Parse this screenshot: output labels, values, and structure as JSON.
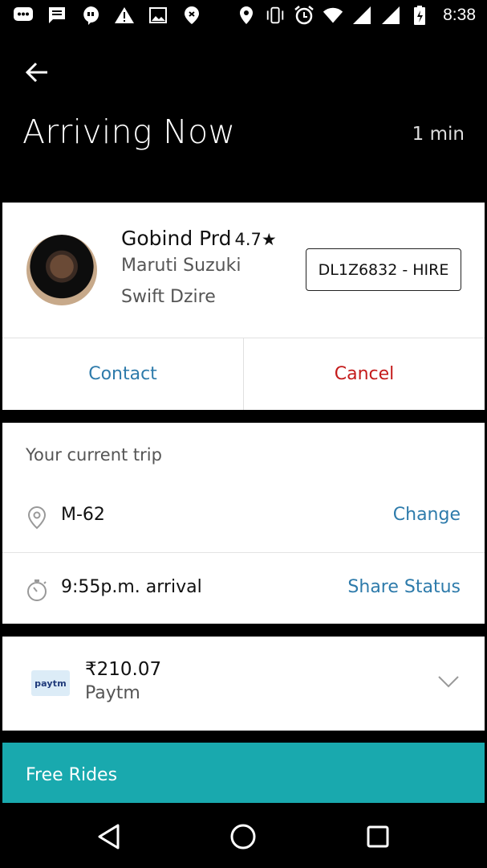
{
  "status_bar": {
    "time": "8:38",
    "left_icons": [
      "messenger-icon",
      "message-icon",
      "chat-icon",
      "warning-icon",
      "image-icon",
      "app-icon"
    ],
    "right_icons": [
      "location-icon",
      "vibrate-icon",
      "alarm-icon",
      "wifi-icon",
      "signal-icon",
      "signal-icon",
      "battery-charging-icon"
    ]
  },
  "header": {
    "title": "Arriving Now",
    "eta": "1 min"
  },
  "driver": {
    "name": "Gobind Prd",
    "rating": "4.7★",
    "car_make": "Maruti Suzuki",
    "car_model": "Swift Dzire",
    "plate": "DL1Z6832 - HIRE"
  },
  "actions": {
    "contact_label": "Contact",
    "cancel_label": "Cancel"
  },
  "trip": {
    "header": "Your current trip",
    "destination": "M-62",
    "change_label": "Change",
    "arrival": "9:55p.m. arrival",
    "share_label": "Share Status"
  },
  "payment": {
    "amount": "₹210.07",
    "method": "Paytm",
    "logo_text": "paytm"
  },
  "promo": {
    "label": "Free Rides"
  },
  "colors": {
    "link": "#2e7bab",
    "cancel": "#c41b1b",
    "promo": "#19a9ae"
  }
}
